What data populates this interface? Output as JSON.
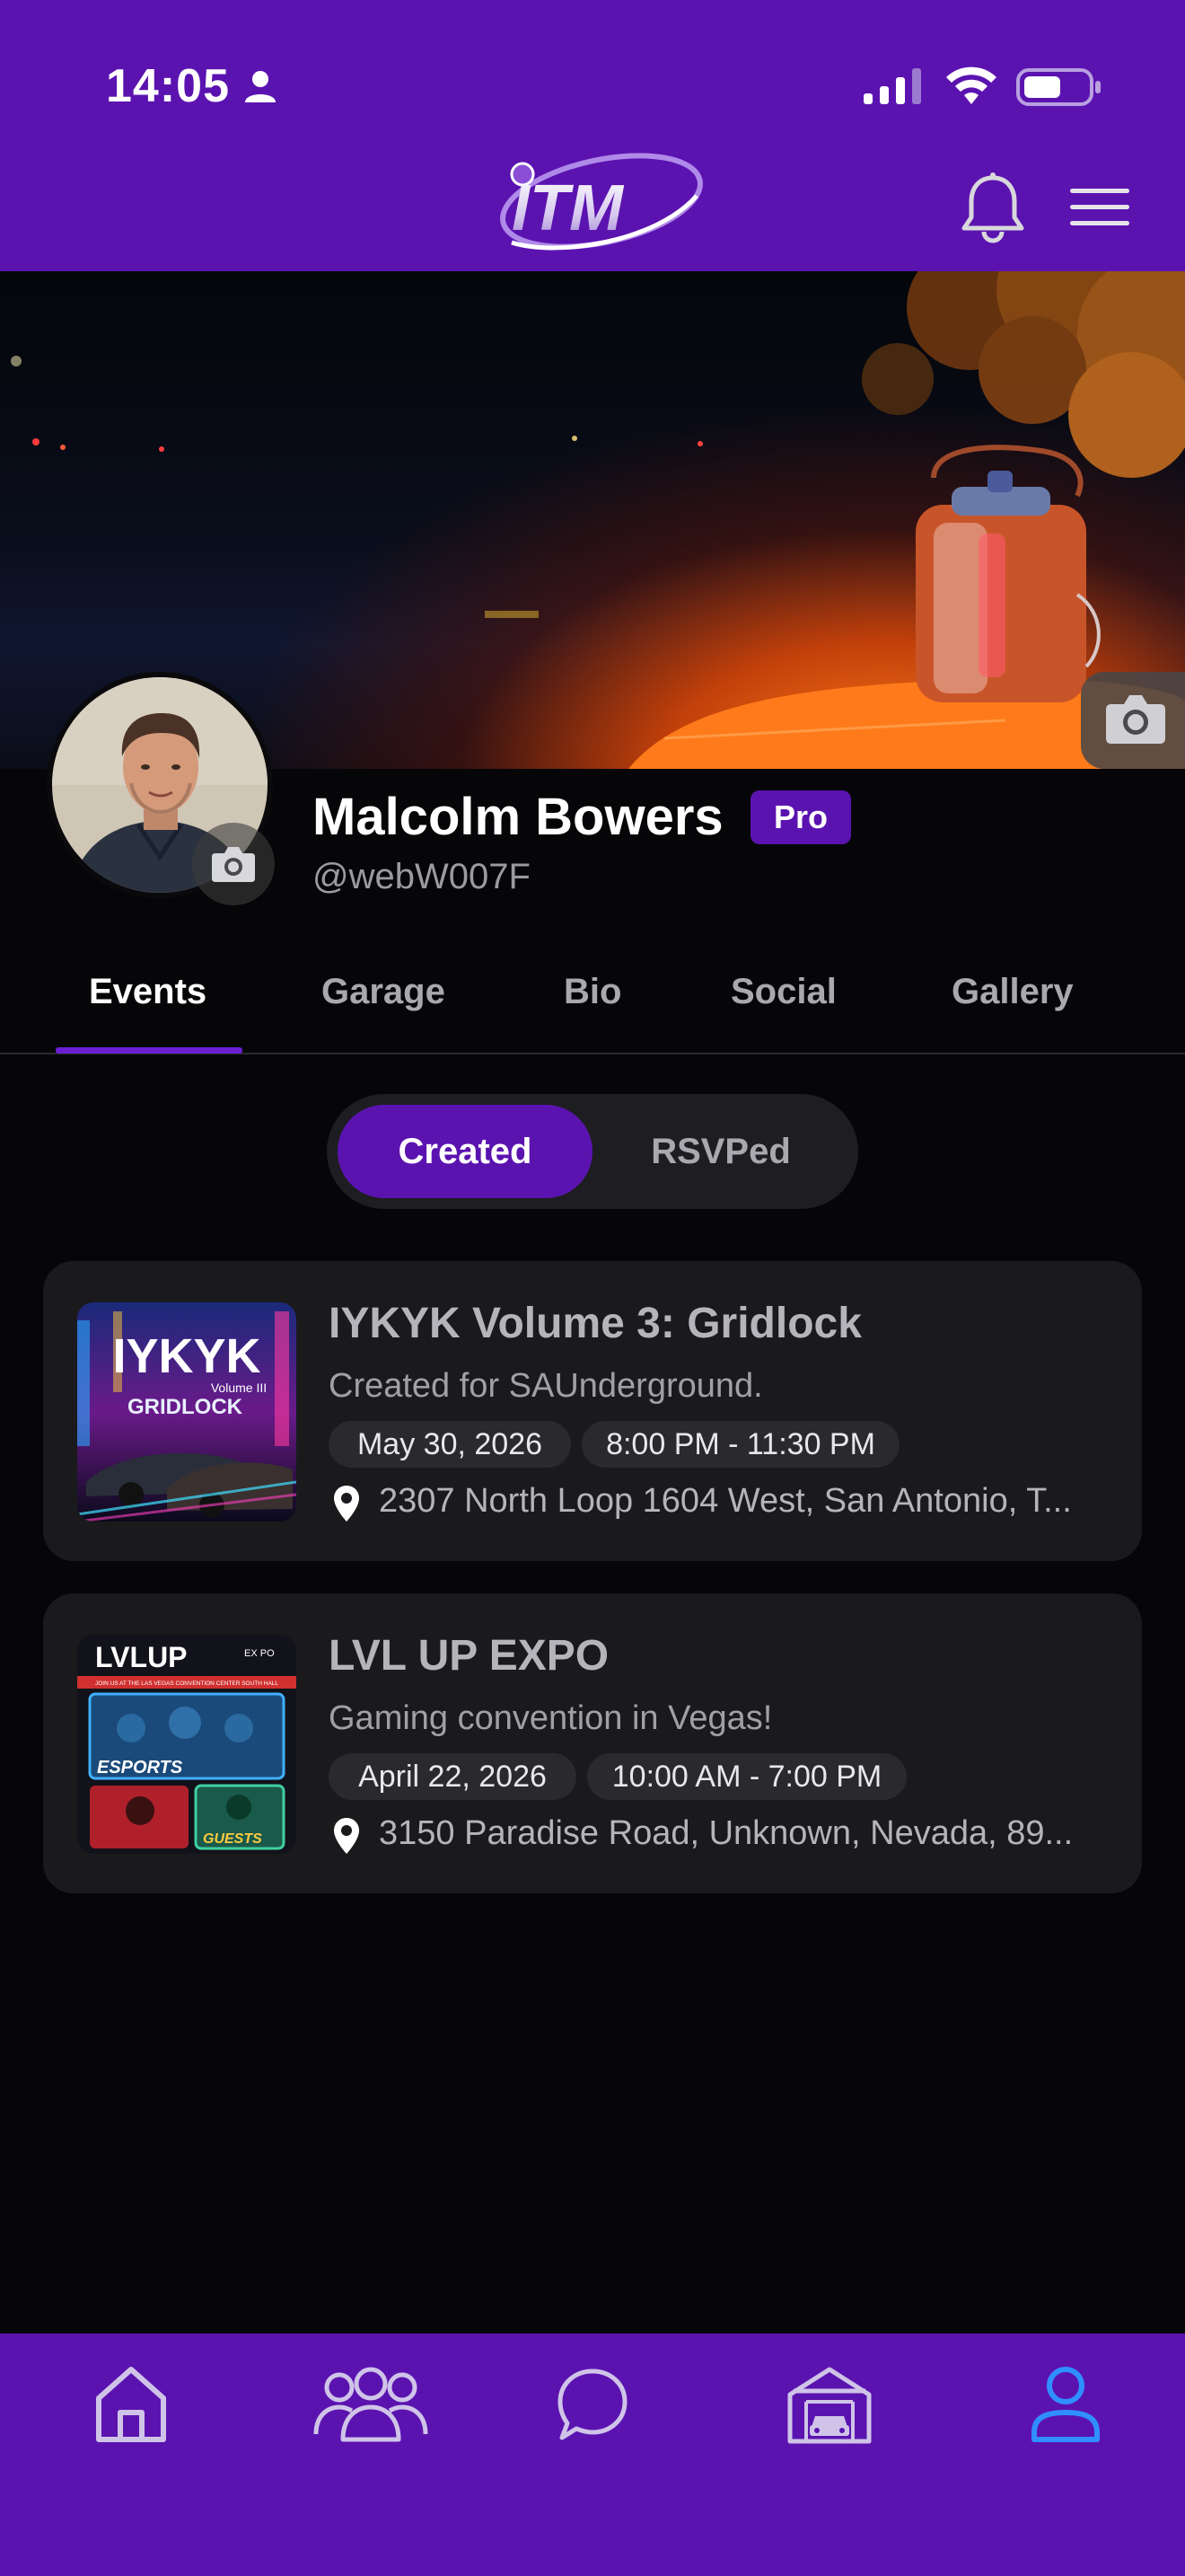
{
  "status_bar": {
    "time": "14:05"
  },
  "header": {
    "logo_text": "ITM"
  },
  "profile": {
    "name": "Malcolm Bowers",
    "badge": "Pro",
    "handle": "@webW007F"
  },
  "tabs": [
    {
      "label": "Events",
      "active": true
    },
    {
      "label": "Garage",
      "active": false
    },
    {
      "label": "Bio",
      "active": false
    },
    {
      "label": "Social",
      "active": false
    },
    {
      "label": "Gallery",
      "active": false
    }
  ],
  "segments": [
    {
      "label": "Created",
      "active": true
    },
    {
      "label": "RSVPed",
      "active": false
    }
  ],
  "events": [
    {
      "title": "IYKYK Volume 3: Gridlock",
      "description": "Created for SAUnderground.",
      "date": "May 30, 2026",
      "time": "8:00 PM - 11:30 PM",
      "location": "2307 North Loop 1604 West, San Antonio, T...",
      "thumb_text": [
        "IYKYK",
        "Volume III",
        "GRIDLOCK"
      ]
    },
    {
      "title": "LVL UP EXPO",
      "description": "Gaming convention in Vegas!",
      "date": "April 22, 2026",
      "time": "10:00 AM - 7:00 PM",
      "location": "3150 Paradise Road, Unknown, Nevada, 89...",
      "thumb_text": [
        "LVLUP",
        "EX PO",
        "JOIN US AT THE LAS VEGAS CONVENTION CENTER SOUTH HALL",
        "ESPORTS",
        "GUESTS"
      ]
    }
  ],
  "bottom_nav": [
    {
      "icon": "home-icon"
    },
    {
      "icon": "people-icon"
    },
    {
      "icon": "chat-icon"
    },
    {
      "icon": "garage-icon"
    },
    {
      "icon": "profile-icon",
      "active": true
    }
  ],
  "colors": {
    "brand": "#5b13b0",
    "active_nav": "#2f8fff"
  }
}
